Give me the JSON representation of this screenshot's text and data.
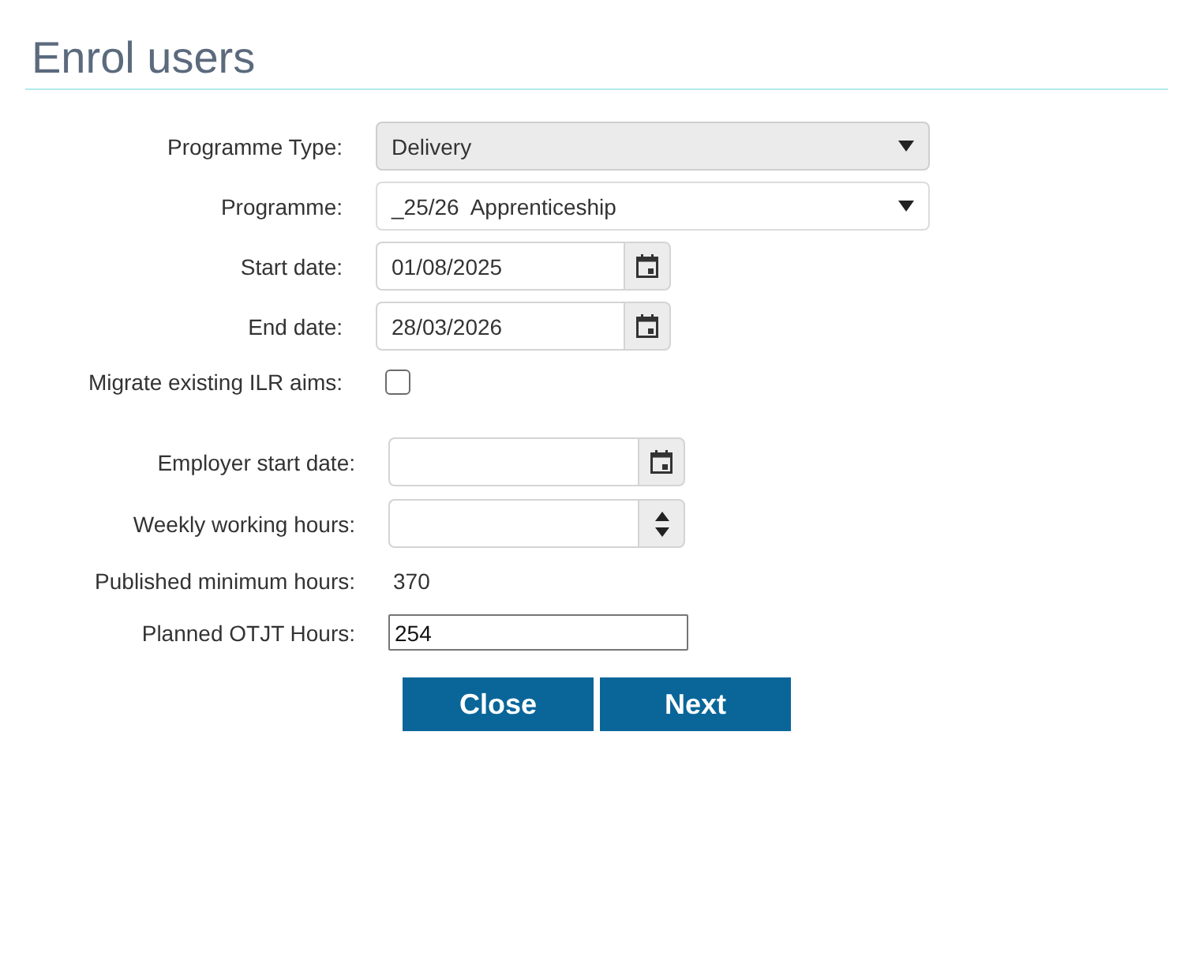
{
  "title": "Enrol users",
  "sections": [
    {
      "fields": [
        {
          "kind": "select",
          "label": "Programme Type:",
          "value": "Delivery",
          "disabled": true
        },
        {
          "kind": "select",
          "label": "Programme:",
          "value": "_25/26  Apprenticeship",
          "disabled": false
        },
        {
          "kind": "date",
          "label": "Start date:",
          "value": "01/08/2025"
        },
        {
          "kind": "date",
          "label": "End date:",
          "value": "28/03/2026"
        },
        {
          "kind": "checkbox",
          "label": "Migrate existing ILR aims:",
          "checked": false
        }
      ]
    },
    {
      "fields": [
        {
          "kind": "date",
          "label": "Employer start date:"
        },
        {
          "kind": "number",
          "label": "Weekly working hours:"
        },
        {
          "kind": "readout",
          "label": "Published minimum hours:",
          "value": "370"
        },
        {
          "kind": "input",
          "label": "Planned OTJT Hours:",
          "value": "254"
        }
      ]
    }
  ],
  "buttons": [
    {
      "label": "Close"
    },
    {
      "label": "Next"
    }
  ]
}
